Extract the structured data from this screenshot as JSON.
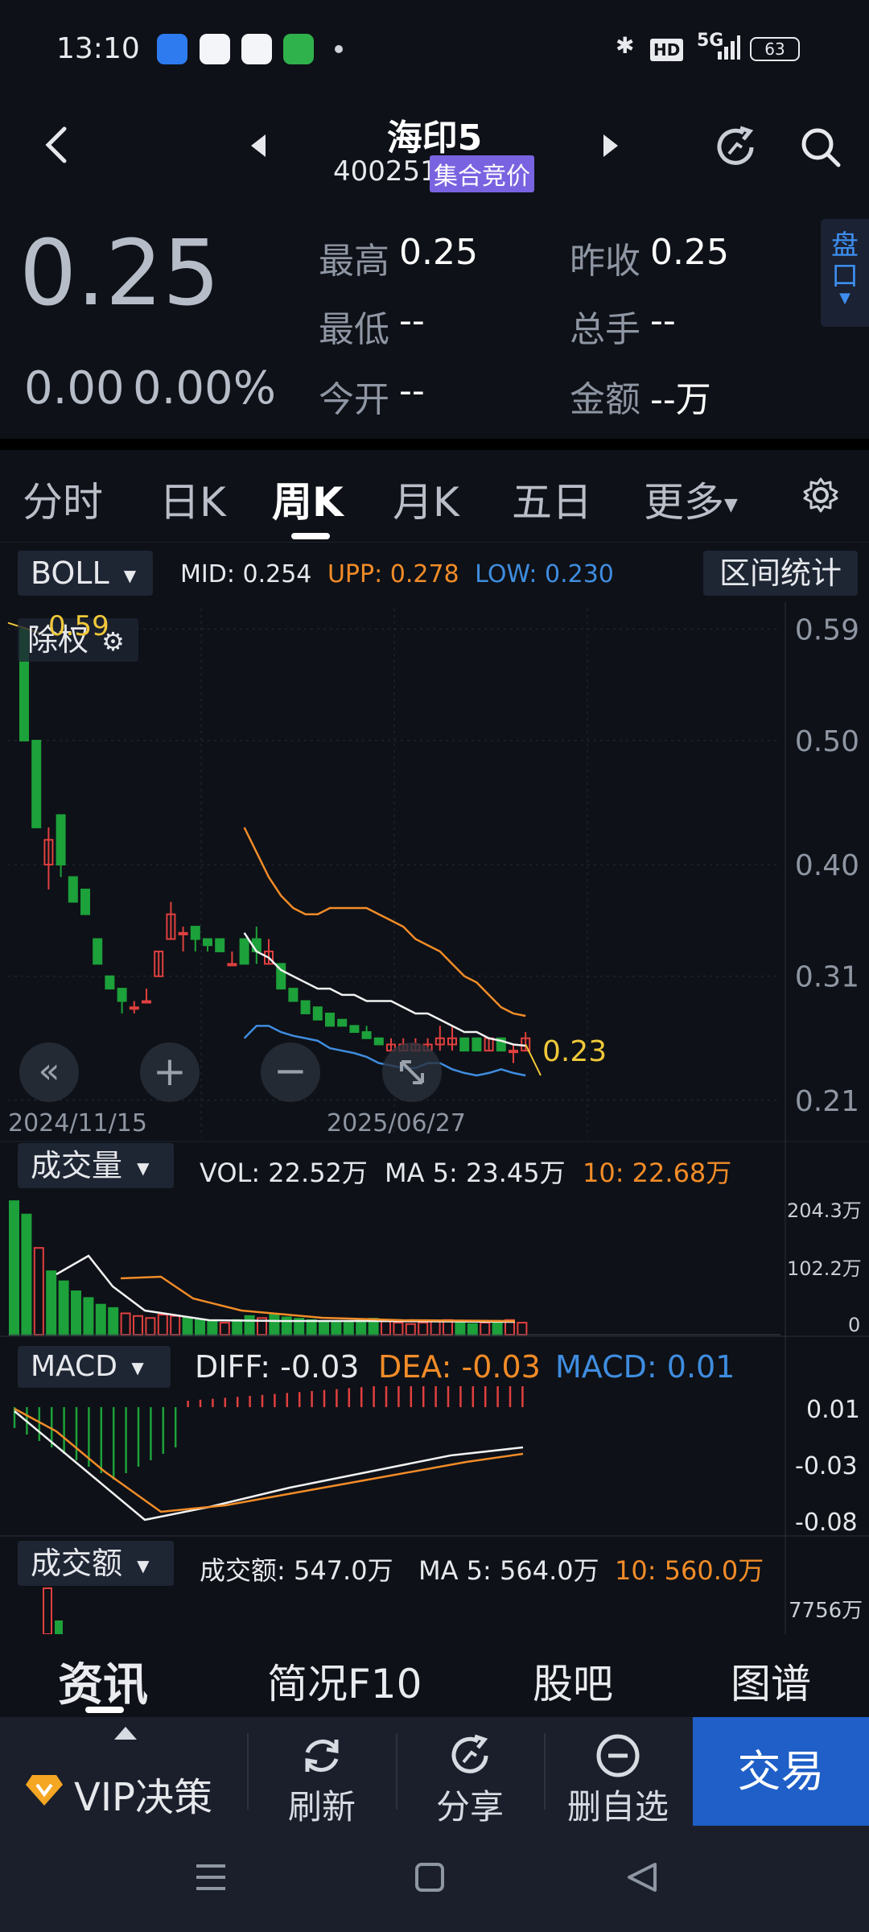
{
  "status_bar": {
    "time": "13:10",
    "hd": "HD",
    "network": "5G",
    "battery": "63"
  },
  "header": {
    "stock_name": "海印5",
    "stock_code": "400251",
    "market_status": "集合竞价"
  },
  "quote": {
    "price": "0.25",
    "change": "0.00",
    "change_pct": "0.00%",
    "high_label": "最高",
    "high": "0.25",
    "prev_close_label": "昨收",
    "prev_close": "0.25",
    "low_label": "最低",
    "low": "--",
    "volume_label": "总手",
    "volume": "--",
    "open_label": "今开",
    "open": "--",
    "amount_label": "金额",
    "amount": "--万",
    "panel_button": "盘口"
  },
  "tabs": [
    {
      "label": "分时"
    },
    {
      "label": "日K"
    },
    {
      "label": "周K"
    },
    {
      "label": "月K"
    },
    {
      "label": "五日"
    },
    {
      "label": "更多"
    }
  ],
  "indicators": {
    "boll": {
      "name": "BOLL",
      "mid_label": "MID:",
      "mid": "0.254",
      "upp_label": "UPP:",
      "upp": "0.278",
      "low_label": "LOW:",
      "low": "0.230"
    },
    "range_stats": "区间统计",
    "ex_rights": "除权",
    "high_marker": "0.59",
    "last_marker": "0.23",
    "date_left": "2024/11/15",
    "date_mid": "2025/06/27",
    "volume": {
      "name": "成交量",
      "vol": "VOL: 22.52万",
      "ma5": "MA 5: 23.45万",
      "ma10": "10: 22.68万",
      "ticks": [
        "204.3万",
        "102.2万",
        "0"
      ]
    },
    "macd": {
      "name": "MACD",
      "diff": "DIFF: -0.03",
      "dea": "DEA: -0.03",
      "macd": "MACD: 0.01",
      "ticks": [
        "0.01",
        "-0.03",
        "-0.08"
      ]
    },
    "amount": {
      "name": "成交额",
      "amt": "成交额: 547.0万",
      "ma5": "MA 5: 564.0万",
      "ma10": "10: 560.0万",
      "tick": "7756万"
    }
  },
  "colors": {
    "up": "#e0403f",
    "down": "#1da13a",
    "upper_band": "#f28c28",
    "lower_band": "#3f8de0",
    "accent": "#7a63e0",
    "yellow": "#f0c83a"
  },
  "bottom_tabs": [
    {
      "label": "资讯"
    },
    {
      "label": "简况F10"
    },
    {
      "label": "股吧"
    },
    {
      "label": "图谱"
    }
  ],
  "actions": [
    {
      "label": "VIP决策"
    },
    {
      "label": "刷新"
    },
    {
      "label": "分享"
    },
    {
      "label": "删自选"
    }
  ],
  "trade_button": "交易",
  "chart_data": {
    "type": "candlestick",
    "title": "",
    "y_ticks": [
      "0.59",
      "0.50",
      "0.40",
      "0.31",
      "0.21"
    ],
    "ylim": [
      0.18,
      0.6
    ],
    "x_labels": [
      "2024/11/15",
      "2025/06/27"
    ],
    "candles": [
      {
        "o": 0.59,
        "c": 0.5,
        "h": 0.59,
        "l": 0.5
      },
      {
        "o": 0.5,
        "c": 0.43,
        "h": 0.5,
        "l": 0.43
      },
      {
        "o": 0.4,
        "c": 0.42,
        "h": 0.43,
        "l": 0.38
      },
      {
        "o": 0.44,
        "c": 0.4,
        "h": 0.44,
        "l": 0.39
      },
      {
        "o": 0.39,
        "c": 0.37,
        "h": 0.39,
        "l": 0.37
      },
      {
        "o": 0.38,
        "c": 0.36,
        "h": 0.38,
        "l": 0.36
      },
      {
        "o": 0.34,
        "c": 0.32,
        "h": 0.34,
        "l": 0.32
      },
      {
        "o": 0.31,
        "c": 0.3,
        "h": 0.31,
        "l": 0.3
      },
      {
        "o": 0.3,
        "c": 0.29,
        "h": 0.3,
        "l": 0.28
      },
      {
        "o": 0.285,
        "c": 0.285,
        "h": 0.29,
        "l": 0.28
      },
      {
        "o": 0.29,
        "c": 0.29,
        "h": 0.3,
        "l": 0.29
      },
      {
        "o": 0.31,
        "c": 0.33,
        "h": 0.33,
        "l": 0.31
      },
      {
        "o": 0.34,
        "c": 0.36,
        "h": 0.37,
        "l": 0.34
      },
      {
        "o": 0.345,
        "c": 0.345,
        "h": 0.35,
        "l": 0.33
      },
      {
        "o": 0.35,
        "c": 0.34,
        "h": 0.35,
        "l": 0.33
      },
      {
        "o": 0.34,
        "c": 0.335,
        "h": 0.34,
        "l": 0.33
      },
      {
        "o": 0.34,
        "c": 0.33,
        "h": 0.34,
        "l": 0.33
      },
      {
        "o": 0.32,
        "c": 0.32,
        "h": 0.33,
        "l": 0.32
      },
      {
        "o": 0.34,
        "c": 0.32,
        "h": 0.34,
        "l": 0.32
      },
      {
        "o": 0.34,
        "c": 0.33,
        "h": 0.35,
        "l": 0.32
      },
      {
        "o": 0.32,
        "c": 0.33,
        "h": 0.34,
        "l": 0.32
      },
      {
        "o": 0.32,
        "c": 0.3,
        "h": 0.32,
        "l": 0.3
      },
      {
        "o": 0.3,
        "c": 0.29,
        "h": 0.3,
        "l": 0.29
      },
      {
        "o": 0.29,
        "c": 0.28,
        "h": 0.29,
        "l": 0.28
      },
      {
        "o": 0.285,
        "c": 0.275,
        "h": 0.285,
        "l": 0.275
      },
      {
        "o": 0.28,
        "c": 0.27,
        "h": 0.28,
        "l": 0.27
      },
      {
        "o": 0.275,
        "c": 0.27,
        "h": 0.275,
        "l": 0.27
      },
      {
        "o": 0.27,
        "c": 0.265,
        "h": 0.27,
        "l": 0.265
      },
      {
        "o": 0.265,
        "c": 0.26,
        "h": 0.27,
        "l": 0.26
      },
      {
        "o": 0.26,
        "c": 0.255,
        "h": 0.26,
        "l": 0.255
      },
      {
        "o": 0.25,
        "c": 0.255,
        "h": 0.26,
        "l": 0.25
      },
      {
        "o": 0.25,
        "c": 0.255,
        "h": 0.26,
        "l": 0.25
      },
      {
        "o": 0.25,
        "c": 0.255,
        "h": 0.26,
        "l": 0.25
      },
      {
        "o": 0.25,
        "c": 0.255,
        "h": 0.26,
        "l": 0.25
      },
      {
        "o": 0.255,
        "c": 0.26,
        "h": 0.27,
        "l": 0.25
      },
      {
        "o": 0.255,
        "c": 0.26,
        "h": 0.27,
        "l": 0.25
      },
      {
        "o": 0.26,
        "c": 0.25,
        "h": 0.26,
        "l": 0.25
      },
      {
        "o": 0.26,
        "c": 0.25,
        "h": 0.26,
        "l": 0.25
      },
      {
        "o": 0.25,
        "c": 0.26,
        "h": 0.26,
        "l": 0.25
      },
      {
        "o": 0.26,
        "c": 0.25,
        "h": 0.26,
        "l": 0.25
      },
      {
        "o": 0.25,
        "c": 0.25,
        "h": 0.255,
        "l": 0.24
      },
      {
        "o": 0.25,
        "c": 0.26,
        "h": 0.265,
        "l": 0.25
      }
    ],
    "boll_mid": [
      null,
      null,
      null,
      null,
      null,
      null,
      null,
      null,
      null,
      null,
      null,
      null,
      null,
      null,
      null,
      null,
      null,
      null,
      0.345,
      0.33,
      0.325,
      0.315,
      0.31,
      0.305,
      0.3,
      0.3,
      0.295,
      0.295,
      0.29,
      0.29,
      0.29,
      0.285,
      0.28,
      0.28,
      0.275,
      0.27,
      0.265,
      0.265,
      0.26,
      0.258,
      0.255,
      0.254
    ],
    "boll_upp": [
      null,
      null,
      null,
      null,
      null,
      null,
      null,
      null,
      null,
      null,
      null,
      null,
      null,
      null,
      null,
      null,
      null,
      null,
      0.43,
      0.41,
      0.39,
      0.375,
      0.365,
      0.36,
      0.36,
      0.365,
      0.365,
      0.365,
      0.365,
      0.36,
      0.355,
      0.35,
      0.34,
      0.335,
      0.33,
      0.32,
      0.31,
      0.305,
      0.295,
      0.285,
      0.28,
      0.278
    ],
    "boll_low": [
      null,
      null,
      null,
      null,
      null,
      null,
      null,
      null,
      null,
      null,
      null,
      null,
      null,
      null,
      null,
      null,
      null,
      null,
      0.26,
      0.27,
      0.27,
      0.265,
      0.262,
      0.26,
      0.258,
      0.252,
      0.25,
      0.248,
      0.245,
      0.24,
      0.238,
      0.236,
      0.236,
      0.24,
      0.24,
      0.235,
      0.232,
      0.23,
      0.232,
      0.235,
      0.232,
      0.23
    ]
  }
}
